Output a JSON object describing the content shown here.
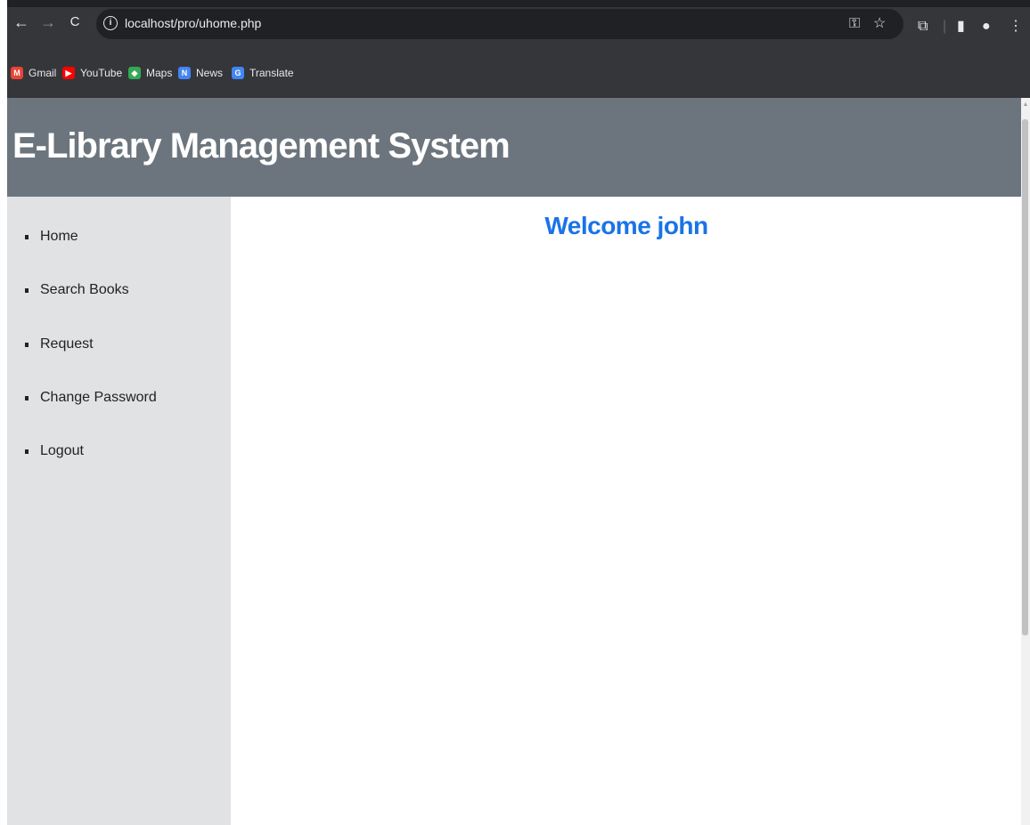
{
  "browser": {
    "url": "localhost/pro/uhome.php",
    "nav": {
      "back_icon": "←",
      "forward_icon": "→",
      "reload_icon": "C"
    },
    "toolbar_icons": {
      "key_icon": "⚿",
      "star_icon": "☆",
      "extensions_icon": "⧉",
      "sidepanel_icon": "▮",
      "profile_icon": "●",
      "menu_icon": "⋮"
    }
  },
  "bookmarks": [
    {
      "label": "Gmail",
      "icon": "M",
      "color": "#ea4335"
    },
    {
      "label": "YouTube",
      "icon": "▶",
      "color": "#ff0000"
    },
    {
      "label": "Maps",
      "icon": "◆",
      "color": "#34a853"
    },
    {
      "label": "News",
      "icon": "N",
      "color": "#4285f4"
    },
    {
      "label": "Translate",
      "icon": "G",
      "color": "#4285f4"
    }
  ],
  "page": {
    "title": "E-Library Management System",
    "welcome": "Welcome john",
    "menu": [
      "Home",
      "Search Books",
      "Request",
      "Change Password",
      "Logout"
    ]
  },
  "colors": {
    "header_bg": "#6c757d",
    "sidebar_bg": "#e1e2e4",
    "welcome_text": "#1a73e8"
  }
}
